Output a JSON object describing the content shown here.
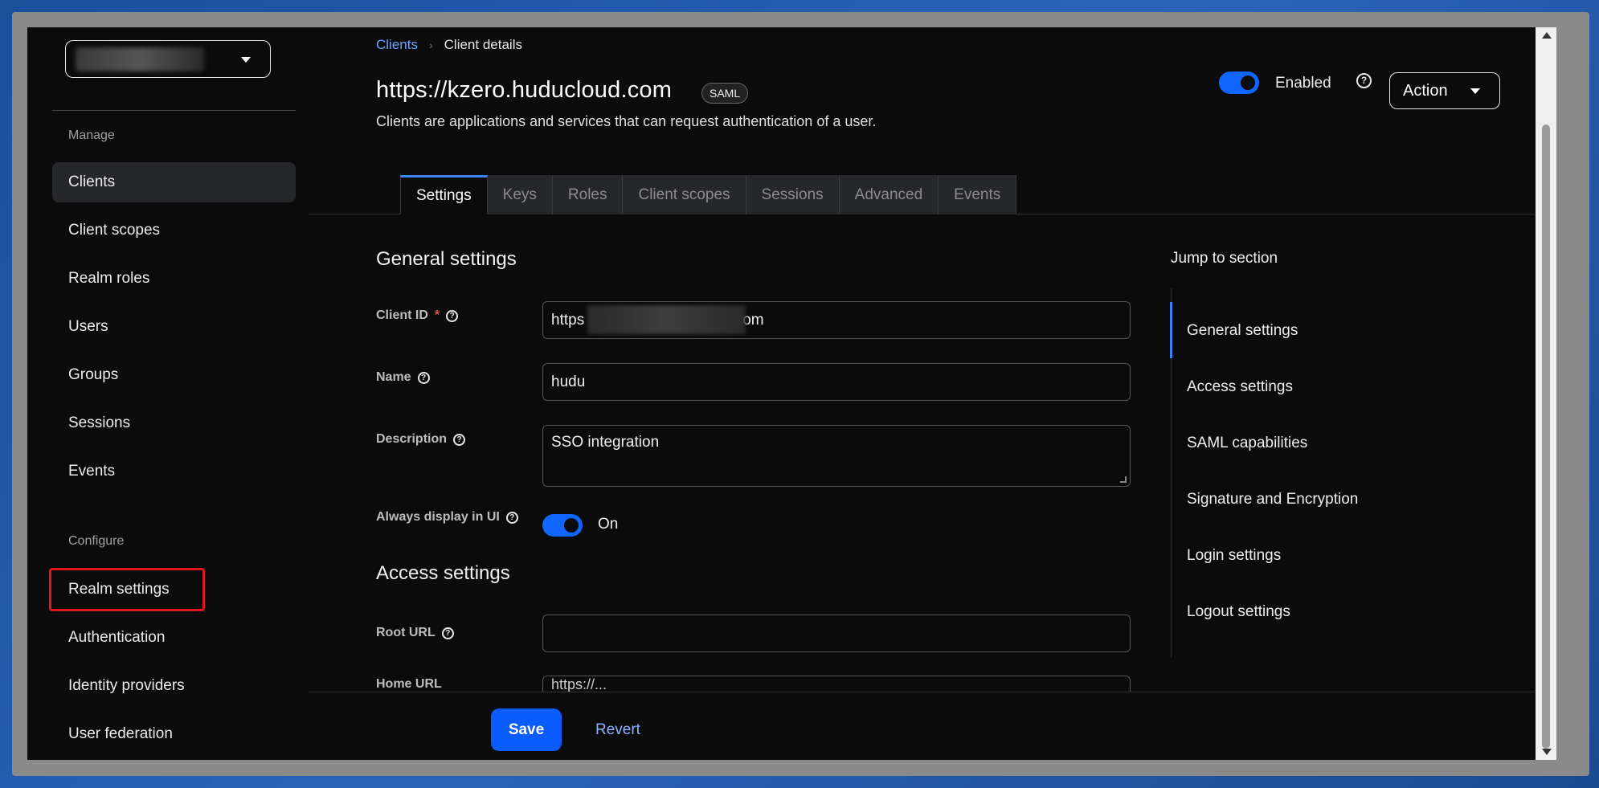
{
  "sidebar": {
    "manage_label": "Manage",
    "configure_label": "Configure",
    "manage_items": [
      {
        "label": "Clients"
      },
      {
        "label": "Client scopes"
      },
      {
        "label": "Realm roles"
      },
      {
        "label": "Users"
      },
      {
        "label": "Groups"
      },
      {
        "label": "Sessions"
      },
      {
        "label": "Events"
      }
    ],
    "configure_items": [
      {
        "label": "Realm settings"
      },
      {
        "label": "Authentication"
      },
      {
        "label": "Identity providers"
      },
      {
        "label": "User federation"
      }
    ]
  },
  "breadcrumb": {
    "parent": "Clients",
    "separator": "›",
    "current": "Client details"
  },
  "header": {
    "title": "https://kzero.huducloud.com",
    "badge": "SAML",
    "subtitle": "Clients are applications and services that can request authentication of a user.",
    "enabled_label": "Enabled",
    "action_label": "Action"
  },
  "tabs": [
    {
      "label": "Settings"
    },
    {
      "label": "Keys"
    },
    {
      "label": "Roles"
    },
    {
      "label": "Client scopes"
    },
    {
      "label": "Sessions"
    },
    {
      "label": "Advanced"
    },
    {
      "label": "Events"
    }
  ],
  "form": {
    "general_title": "General settings",
    "access_title": "Access settings",
    "client_id_label": "Client ID",
    "client_id_prefix": "https",
    "client_id_suffix": "om",
    "name_label": "Name",
    "name_value": "hudu",
    "description_label": "Description",
    "description_value": "SSO integration",
    "always_display_label": "Always display in UI",
    "always_display_value": "On",
    "root_url_label": "Root URL",
    "root_url_value": "",
    "home_url_label": "Home URL",
    "home_url_value": "https://..."
  },
  "jump": {
    "title": "Jump to section",
    "items": [
      {
        "label": "General settings"
      },
      {
        "label": "Access settings"
      },
      {
        "label": "SAML capabilities"
      },
      {
        "label": "Signature and Encryption"
      },
      {
        "label": "Login settings"
      },
      {
        "label": "Logout settings"
      }
    ]
  },
  "footer": {
    "save_label": "Save",
    "revert_label": "Revert"
  },
  "colors": {
    "accent": "#0a5cff",
    "highlight": "#e0161b",
    "background": "#0b0b0c"
  }
}
